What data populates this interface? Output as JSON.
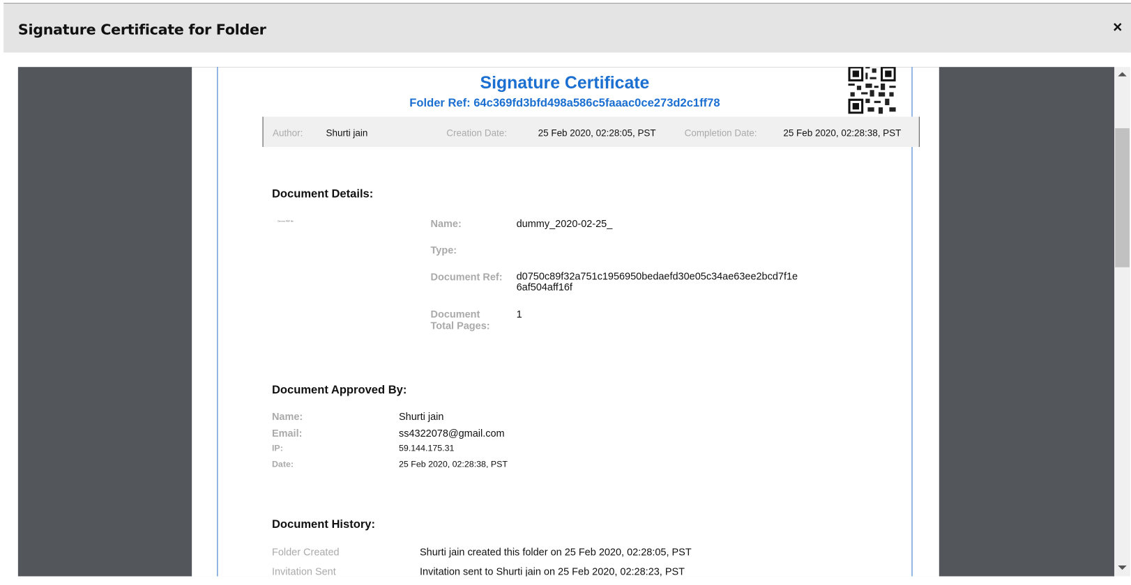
{
  "dialog": {
    "title": "Signature Certificate for Folder",
    "close_label": "×"
  },
  "certificate": {
    "title": "Signature Certificate",
    "folder_ref": "Folder Ref: 64c369fd3bfd498a586c5faaac0ce273d2c1ff78",
    "info": {
      "author_label": "Author:",
      "author": "Shurti jain",
      "creation_label": "Creation Date:",
      "creation": "25 Feb 2020, 02:28:05, PST",
      "completion_label": "Completion Date:",
      "completion": "25 Feb 2020, 02:28:38, PST"
    },
    "details": {
      "heading": "Document Details:",
      "thumbnail_text": "Dummy PDF file",
      "name_label": "Name:",
      "name": "dummy_2020-02-25_",
      "type_label": "Type:",
      "ref_label": "Document Ref:",
      "ref_line1": "d0750c89f32a751c1956950bedaefd30e05c34ae63ee2bcd7f1e",
      "ref_line2": "6af504aff16f",
      "pages_label1": "Document",
      "pages_label2": "Total Pages:",
      "pages": "1"
    },
    "approved": {
      "heading": "Document Approved By:",
      "name_label": "Name:",
      "name": "Shurti jain",
      "email_label": "Email:",
      "email": "ss4322078@gmail.com",
      "ip_label": "IP:",
      "ip": "59.144.175.31",
      "date_label": "Date:",
      "date": "25 Feb 2020, 02:28:38, PST"
    },
    "history": {
      "heading": "Document History:",
      "rows": [
        {
          "event": "Folder Created",
          "detail": "Shurti jain created this folder on 25 Feb 2020, 02:28:05, PST"
        },
        {
          "event": "Invitation Sent",
          "detail": "Invitation sent to Shurti jain on 25 Feb 2020, 02:28:23, PST"
        }
      ]
    }
  }
}
